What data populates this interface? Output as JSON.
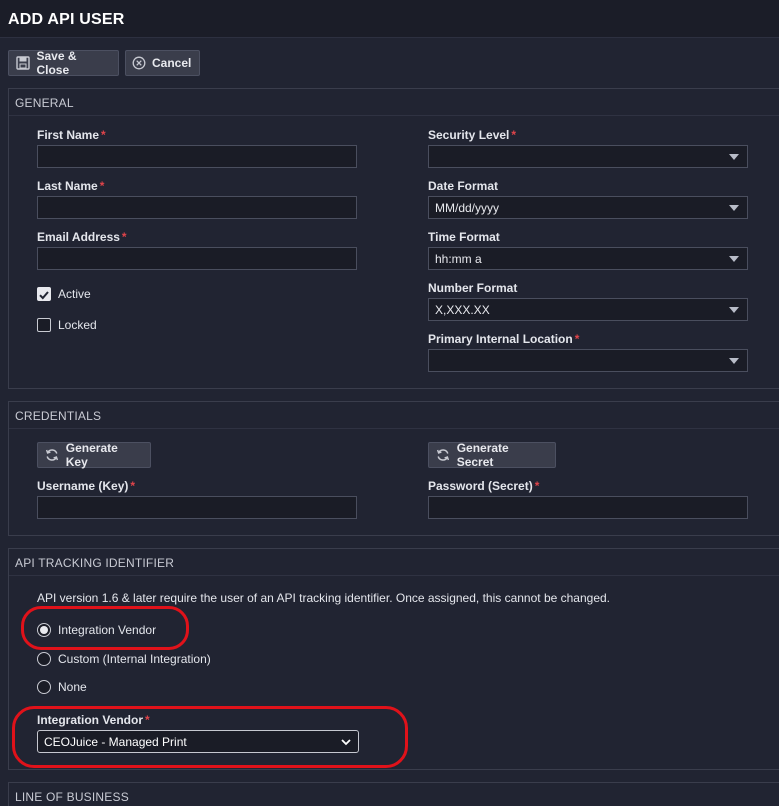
{
  "window": {
    "title": "ADD API USER"
  },
  "toolbar": {
    "save_label": "Save & Close",
    "cancel_label": "Cancel",
    "save_icon": "floppy-disk-icon",
    "cancel_icon": "circle-x-icon"
  },
  "general": {
    "title": "GENERAL",
    "first_name": {
      "label": "First Name",
      "value": ""
    },
    "last_name": {
      "label": "Last Name",
      "value": ""
    },
    "email": {
      "label": "Email Address",
      "value": ""
    },
    "active": {
      "label": "Active",
      "checked": true
    },
    "locked": {
      "label": "Locked",
      "checked": false
    },
    "security_level": {
      "label": "Security Level",
      "value": ""
    },
    "date_format": {
      "label": "Date Format",
      "value": "MM/dd/yyyy"
    },
    "time_format": {
      "label": "Time Format",
      "value": "hh:mm a"
    },
    "number_format": {
      "label": "Number Format",
      "value": "X,XXX.XX"
    },
    "primary_location": {
      "label": "Primary Internal Location",
      "value": ""
    }
  },
  "credentials": {
    "title": "CREDENTIALS",
    "generate_key_label": "Generate Key",
    "generate_secret_label": "Generate Secret",
    "username": {
      "label": "Username (Key)",
      "value": ""
    },
    "password": {
      "label": "Password (Secret)",
      "value": ""
    },
    "refresh_icon": "refresh-icon"
  },
  "tracking": {
    "title": "API TRACKING IDENTIFIER",
    "notice": "API version 1.6 & later require the user of an API tracking identifier. Once assigned, this cannot be changed.",
    "options": [
      {
        "label": "Integration Vendor",
        "selected": true
      },
      {
        "label": "Custom (Internal Integration)",
        "selected": false
      },
      {
        "label": "None",
        "selected": false
      }
    ],
    "vendor": {
      "label": "Integration Vendor",
      "value": "CEOJuice - Managed Print"
    }
  },
  "line_of_business": {
    "title": "LINE OF BUSINESS"
  },
  "required_marker": "*",
  "colors": {
    "background": "#212432",
    "required": "#e0444a",
    "highlight": "#e0121a"
  }
}
